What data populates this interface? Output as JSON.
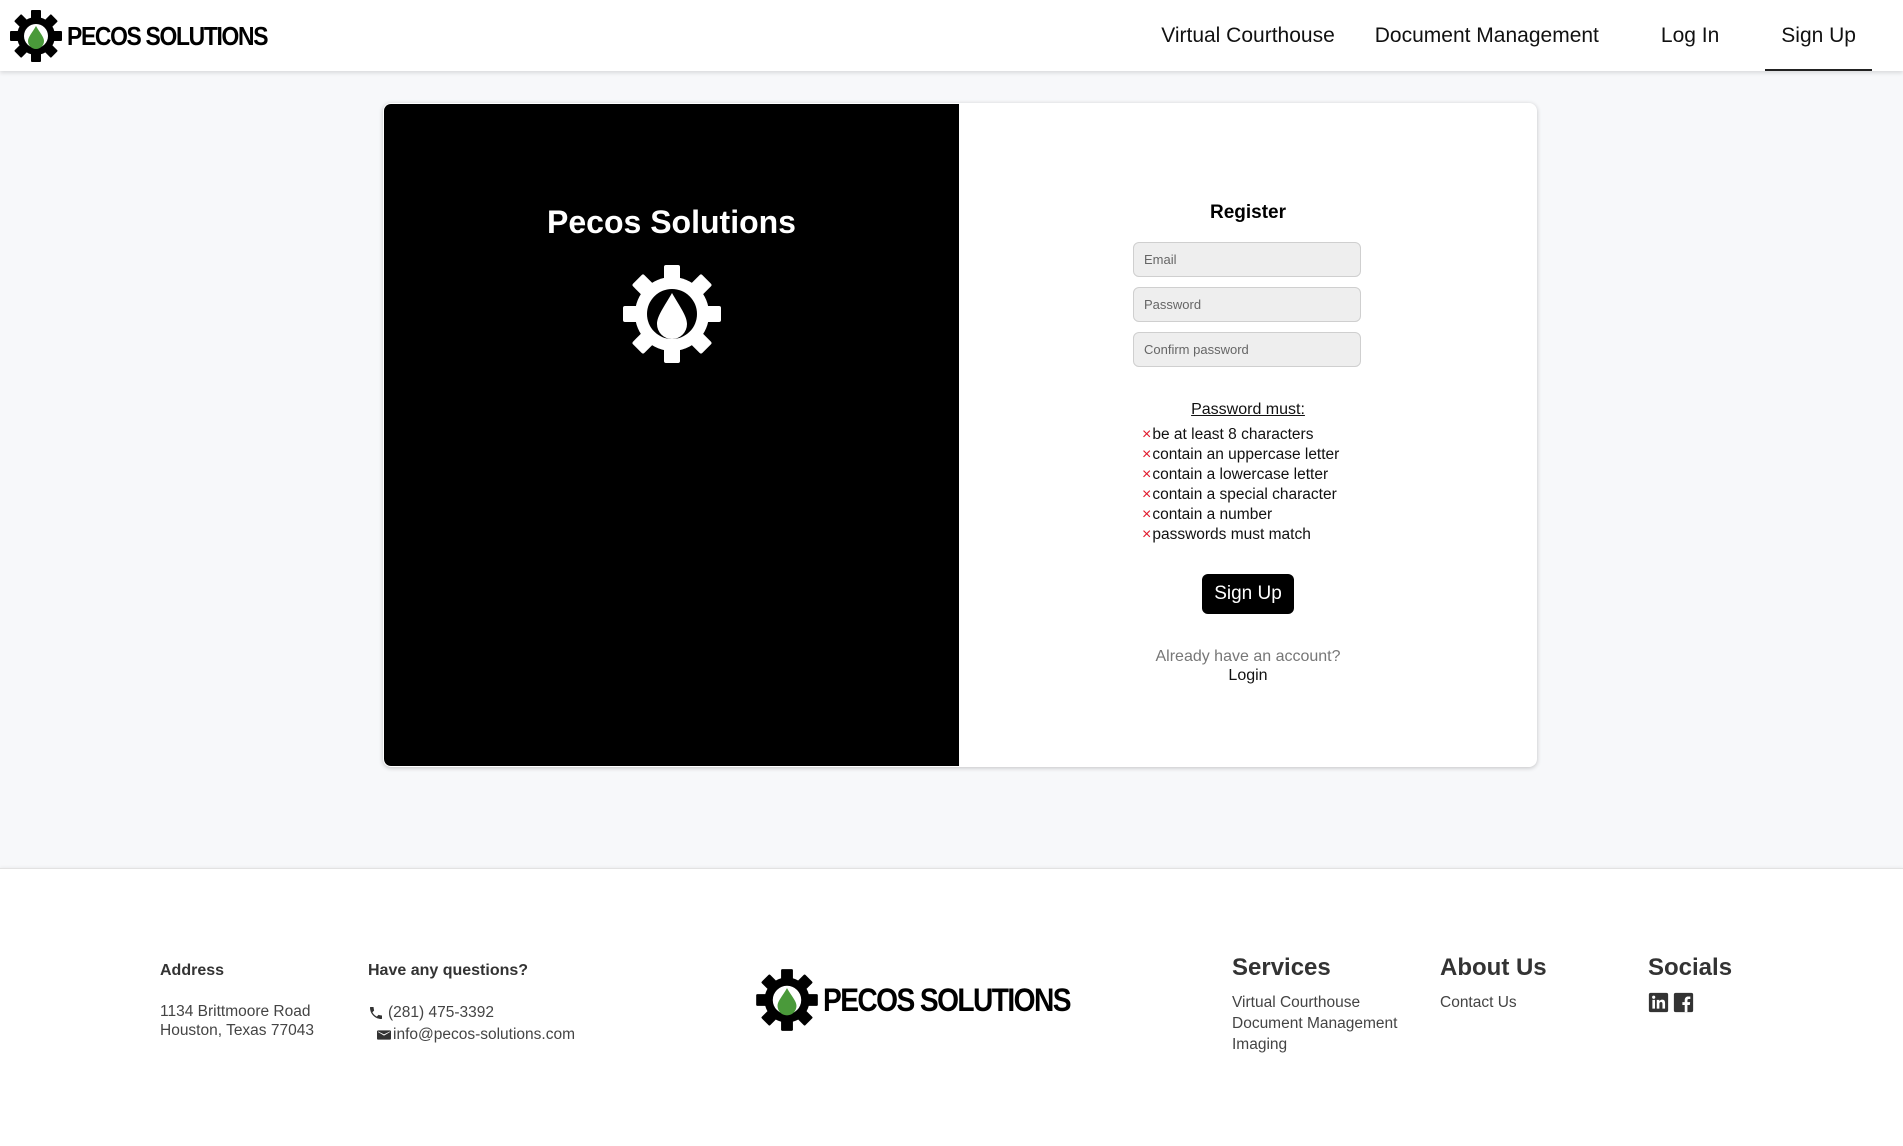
{
  "header": {
    "brand": "PECOS SOLUTIONS",
    "nav": [
      {
        "label": "Virtual Courthouse"
      },
      {
        "label": "Document Management"
      },
      {
        "label": "Log In"
      },
      {
        "label": "Sign Up",
        "active": true
      }
    ]
  },
  "card": {
    "left_title": "Pecos Solutions",
    "logo_icon": "gear-drop-icon",
    "register_title": "Register",
    "fields": {
      "email_placeholder": "Email",
      "password_placeholder": "Password",
      "confirm_placeholder": "Confirm password",
      "email_value": "",
      "password_value": "",
      "confirm_value": ""
    },
    "rules_title": "Password must:",
    "rules": [
      "be at least 8 characters",
      "contain an uppercase letter",
      "contain a lowercase letter",
      "contain a special character",
      "contain a number",
      "passwords must match"
    ],
    "rule_status_icon": "×",
    "signup_label": "Sign Up",
    "already_text": "Already have an account?",
    "login_label": "Login"
  },
  "footer": {
    "address_heading": "Address",
    "address_lines": [
      "1134 Brittmoore Road",
      "Houston, Texas 77043"
    ],
    "questions_heading": "Have any questions?",
    "phone": "(281) 475-3392",
    "email": "info@pecos-solutions.com",
    "brand": "PECOS SOLUTIONS",
    "services_heading": "Services",
    "services": [
      "Virtual Courthouse",
      "Document Management",
      "Imaging"
    ],
    "about_heading": "About Us",
    "about": [
      "Contact Us"
    ],
    "socials_heading": "Socials",
    "socials": [
      "linkedin-icon",
      "facebook-icon"
    ]
  },
  "colors": {
    "accent_black": "#000000",
    "drop_green": "#4a9a3a",
    "rule_fail_red": "#e0192b",
    "background": "#f7f8fa"
  }
}
